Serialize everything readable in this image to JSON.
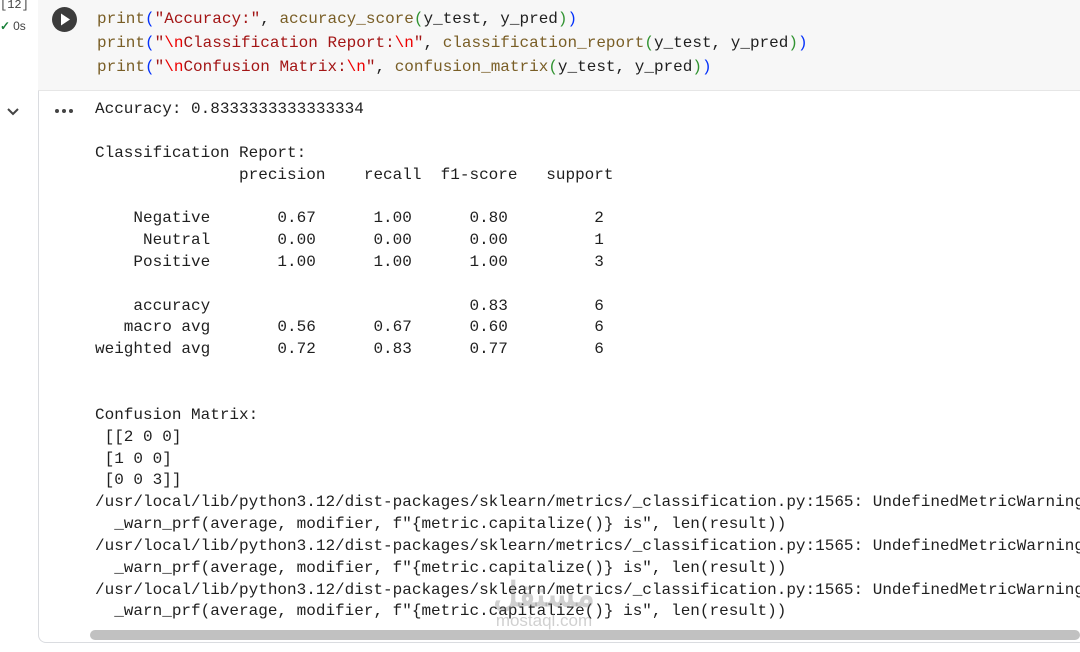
{
  "cell": {
    "execution_count": "[12]",
    "status_duration": "0s",
    "code_lines": [
      [
        {
          "t": "print",
          "c": "fn"
        },
        {
          "t": "(",
          "c": "p1"
        },
        {
          "t": "\"Accuracy:\"",
          "c": "str"
        },
        {
          "t": ", ",
          "c": "plain"
        },
        {
          "t": "accuracy_score",
          "c": "fn"
        },
        {
          "t": "(",
          "c": "p2"
        },
        {
          "t": "y_test",
          "c": "plain"
        },
        {
          "t": ", ",
          "c": "plain"
        },
        {
          "t": "y_pred",
          "c": "plain"
        },
        {
          "t": ")",
          "c": "p2"
        },
        {
          "t": ")",
          "c": "p1"
        }
      ],
      [
        {
          "t": "print",
          "c": "fn"
        },
        {
          "t": "(",
          "c": "p1"
        },
        {
          "t": "\"",
          "c": "str"
        },
        {
          "t": "\\n",
          "c": "esc"
        },
        {
          "t": "Classification Report:",
          "c": "str"
        },
        {
          "t": "\\n",
          "c": "esc"
        },
        {
          "t": "\"",
          "c": "str"
        },
        {
          "t": ", ",
          "c": "plain"
        },
        {
          "t": "classification_report",
          "c": "fn"
        },
        {
          "t": "(",
          "c": "p2"
        },
        {
          "t": "y_test",
          "c": "plain"
        },
        {
          "t": ", ",
          "c": "plain"
        },
        {
          "t": "y_pred",
          "c": "plain"
        },
        {
          "t": ")",
          "c": "p2"
        },
        {
          "t": ")",
          "c": "p1"
        }
      ],
      [
        {
          "t": "print",
          "c": "fn"
        },
        {
          "t": "(",
          "c": "p1"
        },
        {
          "t": "\"",
          "c": "str"
        },
        {
          "t": "\\n",
          "c": "esc"
        },
        {
          "t": "Confusion Matrix:",
          "c": "str"
        },
        {
          "t": "\\n",
          "c": "esc"
        },
        {
          "t": "\"",
          "c": "str"
        },
        {
          "t": ", ",
          "c": "plain"
        },
        {
          "t": "confusion_matrix",
          "c": "fn"
        },
        {
          "t": "(",
          "c": "p2"
        },
        {
          "t": "y_test",
          "c": "plain"
        },
        {
          "t": ", ",
          "c": "plain"
        },
        {
          "t": "y_pred",
          "c": "plain"
        },
        {
          "t": ")",
          "c": "p2"
        },
        {
          "t": ")",
          "c": "p1"
        }
      ]
    ]
  },
  "output": {
    "lines": [
      "Accuracy: 0.8333333333333334",
      "",
      "Classification Report:",
      "               precision    recall  f1-score   support",
      "",
      "    Negative       0.67      1.00      0.80         2",
      "     Neutral       0.00      0.00      0.00         1",
      "    Positive       1.00      1.00      1.00         3",
      "",
      "    accuracy                           0.83         6",
      "   macro avg       0.56      0.67      0.60         6",
      "weighted avg       0.72      0.83      0.77         6",
      "",
      "",
      "Confusion Matrix:",
      " [[2 0 0]",
      " [1 0 0]",
      " [0 0 3]]",
      "/usr/local/lib/python3.12/dist-packages/sklearn/metrics/_classification.py:1565: UndefinedMetricWarning",
      "  _warn_prf(average, modifier, f\"{metric.capitalize()} is\", len(result))",
      "/usr/local/lib/python3.12/dist-packages/sklearn/metrics/_classification.py:1565: UndefinedMetricWarning",
      "  _warn_prf(average, modifier, f\"{metric.capitalize()} is\", len(result))",
      "/usr/local/lib/python3.12/dist-packages/sklearn/metrics/_classification.py:1565: UndefinedMetricWarning",
      "  _warn_prf(average, modifier, f\"{metric.capitalize()} is\", len(result))"
    ]
  },
  "watermark": {
    "logo_text": "مستقل",
    "site": "mostaql.com"
  },
  "icons": {
    "run": "play-icon",
    "status": "check-icon",
    "collapse": "chevron-down-icon",
    "menu": "more-horiz-icon"
  },
  "colors": {
    "success": "#188038",
    "code_background": "#f7f7f7",
    "scrollbar": "#c1c1c1"
  }
}
